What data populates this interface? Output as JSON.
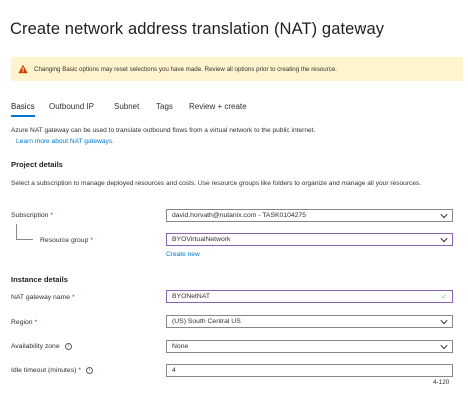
{
  "header": {
    "title": "Create network address translation (NAT) gateway",
    "more": "···"
  },
  "warning": {
    "text": "Changing Basic options may reset selections you have made. Review all options prior to creating the resource.",
    "color": "#fff4ce",
    "icon": "warning-triangle-icon"
  },
  "tabs": [
    {
      "label": "Basics",
      "active": true
    },
    {
      "label": "Outbound IP"
    },
    {
      "label": "Subnet"
    },
    {
      "label": "Tags"
    },
    {
      "label": "Review + create"
    }
  ],
  "intro": {
    "description": "Azure NAT gateway can be used to translate outbound flows from a virtual network to the public internet.",
    "learn_more": "Learn more about NAT gateways."
  },
  "project": {
    "heading": "Project details",
    "description": "Select a subscription to manage deployed resources and costs. Use resource groups like folders to organize and manage all your resources.",
    "subscription_label": "Subscription",
    "subscription_value": "david.horvath@nutanix.com - TASK0104275",
    "resource_group_label": "Resource group",
    "resource_group_value": "BYOVirtualNetwork",
    "create_new": "Create new"
  },
  "instance": {
    "heading": "Instance details",
    "name_label": "NAT gateway name",
    "name_value": "BYONetNAT",
    "region_label": "Region",
    "region_value": "(US) South Central US",
    "zone_label": "Availability zone",
    "zone_value": "None",
    "timeout_label": "Idle timeout (minutes)",
    "timeout_value": "4",
    "timeout_range": "4-120"
  },
  "required_marker": "*",
  "info_glyph": "i",
  "colors": {
    "accent": "#0078d4",
    "required": "#a4262c",
    "focus_border": "#8764b8",
    "valid": "#7fba7a"
  }
}
